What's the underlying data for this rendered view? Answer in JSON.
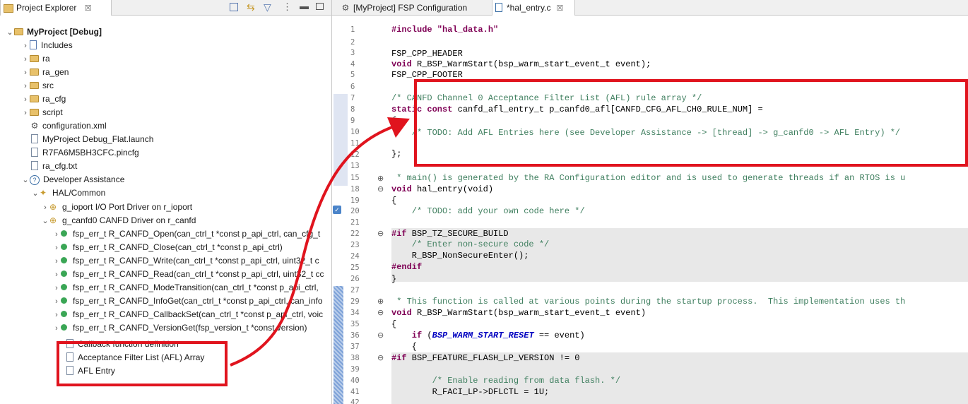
{
  "explorer": {
    "tab_label": "Project Explorer",
    "tab_close": "☒",
    "toolbar_icons": [
      "collapse-all-icon",
      "link-editor-icon",
      "filter-icon",
      "view-menu-icon",
      "minimize-icon",
      "maximize-icon"
    ],
    "items": [
      {
        "label": "MyProject [Debug]",
        "bold": true
      },
      {
        "label": "Includes"
      },
      {
        "label": "ra"
      },
      {
        "label": "ra_gen"
      },
      {
        "label": "src"
      },
      {
        "label": "ra_cfg"
      },
      {
        "label": "script"
      },
      {
        "label": "configuration.xml"
      },
      {
        "label": "MyProject Debug_Flat.launch"
      },
      {
        "label": "R7FA6M5BH3CFC.pincfg"
      },
      {
        "label": "ra_cfg.txt"
      },
      {
        "label": "Developer Assistance"
      },
      {
        "label": "HAL/Common"
      },
      {
        "label": "g_ioport I/O Port Driver on r_ioport"
      },
      {
        "label": "g_canfd0 CANFD Driver on r_canfd"
      },
      {
        "label": "fsp_err_t R_CANFD_Open(can_ctrl_t *const p_api_ctrl, can_cfg_t"
      },
      {
        "label": "fsp_err_t R_CANFD_Close(can_ctrl_t *const p_api_ctrl)"
      },
      {
        "label": "fsp_err_t R_CANFD_Write(can_ctrl_t *const p_api_ctrl, uint32_t c"
      },
      {
        "label": "fsp_err_t R_CANFD_Read(can_ctrl_t *const p_api_ctrl, uint32_t cc"
      },
      {
        "label": "fsp_err_t R_CANFD_ModeTransition(can_ctrl_t *const p_api_ctrl,"
      },
      {
        "label": "fsp_err_t R_CANFD_InfoGet(can_ctrl_t *const p_api_ctrl, can_info"
      },
      {
        "label": "fsp_err_t R_CANFD_CallbackSet(can_ctrl_t *const p_api_ctrl, voic"
      },
      {
        "label": "fsp_err_t R_CANFD_VersionGet(fsp_version_t *const version)"
      },
      {
        "label": "Callback function definition"
      },
      {
        "label": "Acceptance Filter List (AFL) Array"
      },
      {
        "label": "AFL Entry"
      }
    ]
  },
  "editor": {
    "tabs": [
      {
        "label": "[MyProject] FSP Configuration"
      },
      {
        "label": "*hal_entry.c",
        "close": "☒"
      }
    ],
    "line_numbers": [
      "1",
      "2",
      "3",
      "4",
      "5",
      "6",
      "7",
      "8",
      "9",
      "10",
      "11",
      "12",
      "13",
      "15",
      "18",
      "19",
      "20",
      "21",
      "22",
      "23",
      "24",
      "25",
      "26",
      "27",
      "29",
      "34",
      "35",
      "36",
      "37",
      "38",
      "39",
      "40",
      "41",
      "42"
    ],
    "lines": {
      "l1": "#include \"hal_data.h\"",
      "l3": "FSP_CPP_HEADER",
      "l4a": "void",
      "l4b": " R_BSP_WarmStart(bsp_warm_start_event_t event);",
      "l5": "FSP_CPP_FOOTER",
      "l7": "/* CANFD Channel 0 Acceptance Filter List (AFL) rule array */",
      "l8a": "static const",
      "l8b": " canfd_afl_entry_t p_canfd0_afl[CANFD_CFG_AFL_CH0_RULE_NUM] =",
      "l9": "{",
      "l10": "    /* TODO: Add AFL Entries here (see Developer Assistance -> [thread] -> g_canfd0 -> AFL Entry) */",
      "l12": "};",
      "l15": " * main() is generated by the RA Configuration editor and is used to generate threads if an RTOS is u",
      "l18a": "void",
      "l18b": " hal_entry(void)",
      "l19": "{",
      "l20": "    /* TODO: add your own code here */",
      "l22a": "#if",
      "l22b": " BSP_TZ_SECURE_BUILD",
      "l23": "    /* Enter non-secure code */",
      "l24": "    R_BSP_NonSecureEnter();",
      "l25": "#endif",
      "l26": "}",
      "l29": " * This function is called at various points during the startup process.  This implementation uses th",
      "l34a": "void",
      "l34b": " R_BSP_WarmStart(bsp_warm_start_event_t event)",
      "l35": "{",
      "l36a": "    if",
      "l36b": " (",
      "l36c": "BSP_WARM_START_RESET",
      "l36d": " == event)",
      "l37": "    {",
      "l38a": "#if",
      "l38b": " BSP_FEATURE_FLASH_LP_VERSION != 0",
      "l40": "        /* Enable reading from data flash. */",
      "l41": "        R_FACI_LP->DFLCTL = 1U;"
    }
  },
  "colors": {
    "annotation": "#e0141e",
    "keyword": "#7f0055",
    "comment": "#3f7f5f"
  }
}
